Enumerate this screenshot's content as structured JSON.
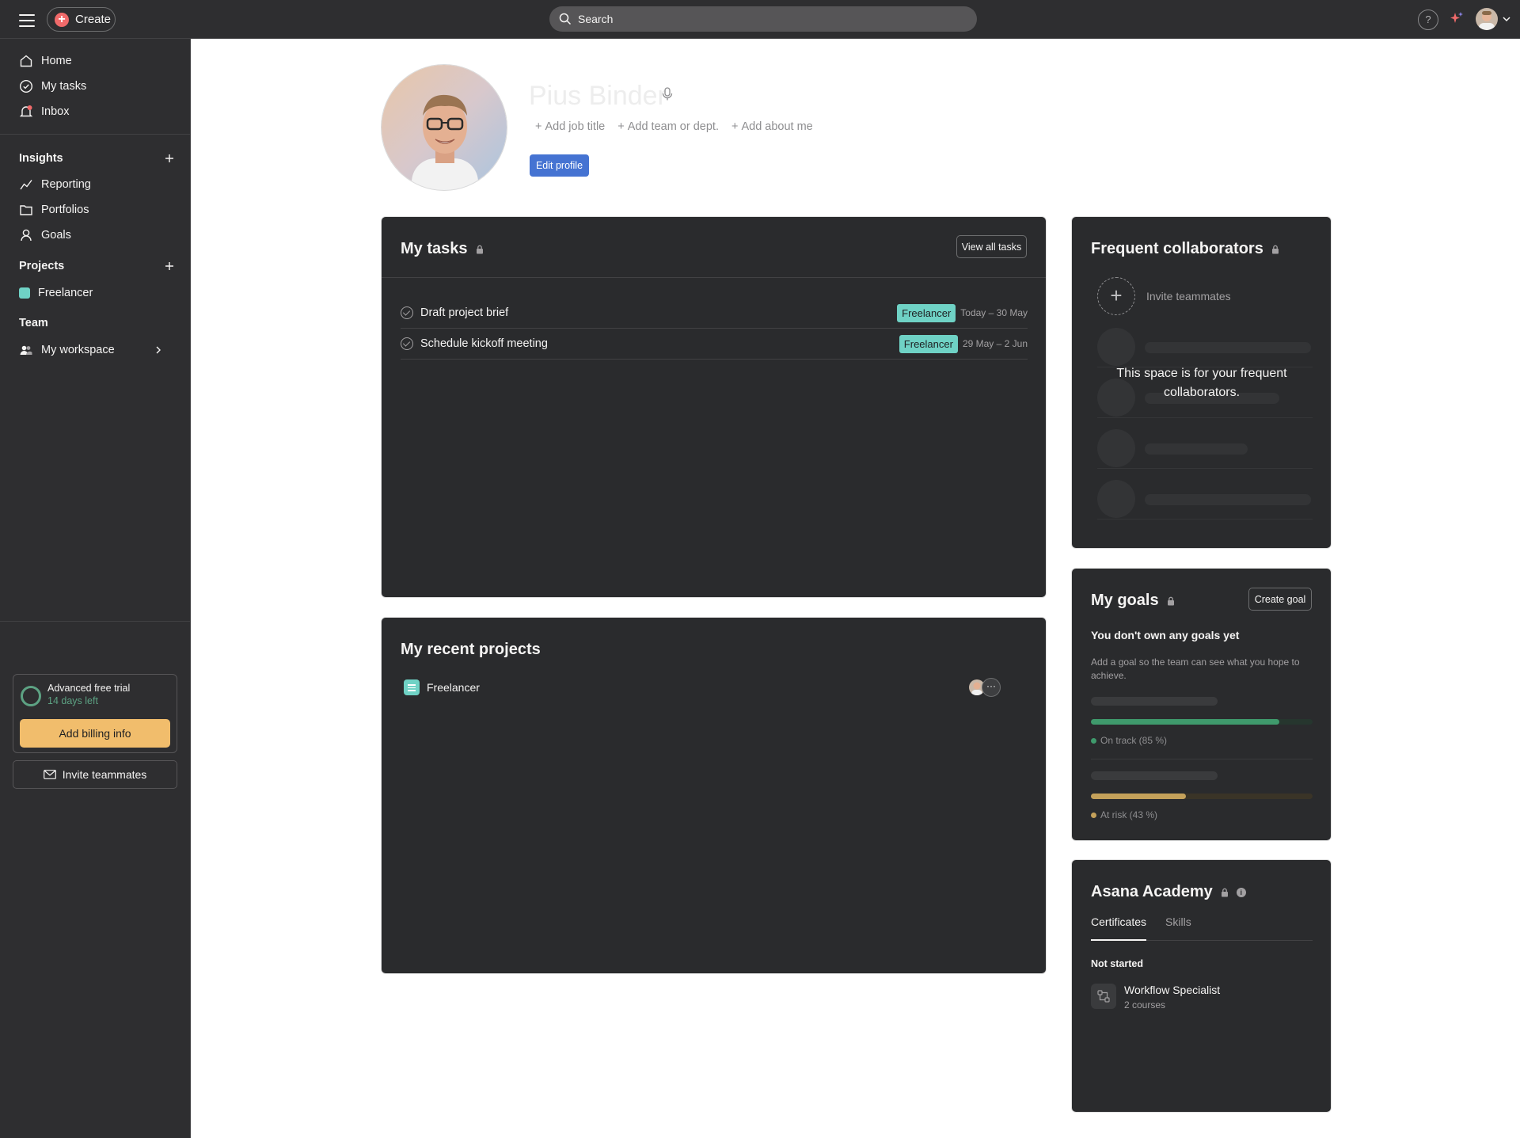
{
  "topbar": {
    "create_label": "Create",
    "search_placeholder": "Search",
    "help_label": "?"
  },
  "sidebar": {
    "nav": [
      {
        "label": "Home",
        "icon": "home-icon"
      },
      {
        "label": "My tasks",
        "icon": "check-circle-icon"
      },
      {
        "label": "Inbox",
        "icon": "bell-icon"
      }
    ],
    "insights_label": "Insights",
    "insights_items": [
      {
        "label": "Reporting",
        "icon": "line-chart-icon"
      },
      {
        "label": "Portfolios",
        "icon": "folder-icon"
      },
      {
        "label": "Goals",
        "icon": "person-icon"
      }
    ],
    "projects_label": "Projects",
    "projects": [
      {
        "label": "Freelancer",
        "color": "#6fd2c5"
      }
    ],
    "team_label": "Team",
    "team_items": [
      {
        "label": "My workspace",
        "icon": "people-icon"
      }
    ],
    "trial": {
      "title": "Advanced free trial",
      "days_left": "14 days left",
      "billing_label": "Add billing info"
    },
    "invite_label": "Invite teammates"
  },
  "profile": {
    "name": "Pius Binder",
    "links": [
      "Add job title",
      "Add team or dept.",
      "Add about me"
    ],
    "edit_label": "Edit profile"
  },
  "my_tasks": {
    "title": "My tasks",
    "view_all_label": "View all tasks",
    "tasks": [
      {
        "name": "Draft project brief",
        "tag": "Freelancer",
        "date": "Today – 30 May"
      },
      {
        "name": "Schedule kickoff meeting",
        "tag": "Freelancer",
        "date": "29 May – 2 Jun"
      }
    ]
  },
  "recent_projects": {
    "title": "My recent projects",
    "projects": [
      {
        "name": "Freelancer",
        "more_label": "···"
      }
    ]
  },
  "collaborators": {
    "title": "Frequent collaborators",
    "invite_label": "Invite teammates",
    "invite_glyph": "+",
    "empty_message": "This space is for your frequent collaborators."
  },
  "goals": {
    "title": "My goals",
    "create_label": "Create goal",
    "empty_heading": "You don't own any goals yet",
    "empty_sub": "Add a goal so the team can see what you hope to achieve.",
    "examples": [
      {
        "status": "On track (85 %)",
        "progress": 0.85,
        "color": "#3f9a6c",
        "track": "#26362e"
      },
      {
        "status": "At risk (43 %)",
        "progress": 0.43,
        "color": "#c4a15a",
        "track": "#3a3427"
      }
    ]
  },
  "academy": {
    "title": "Asana Academy",
    "info_glyph": "i",
    "tabs": [
      "Certificates",
      "Skills"
    ],
    "status_label": "Not started",
    "course_title": "Workflow Specialist",
    "course_sub": "2 courses"
  },
  "colors": {
    "accent_blue": "#4573d2",
    "billing_yellow": "#f1bd6c",
    "project_teal": "#6fd2c5",
    "create_red": "#f06a6a"
  }
}
